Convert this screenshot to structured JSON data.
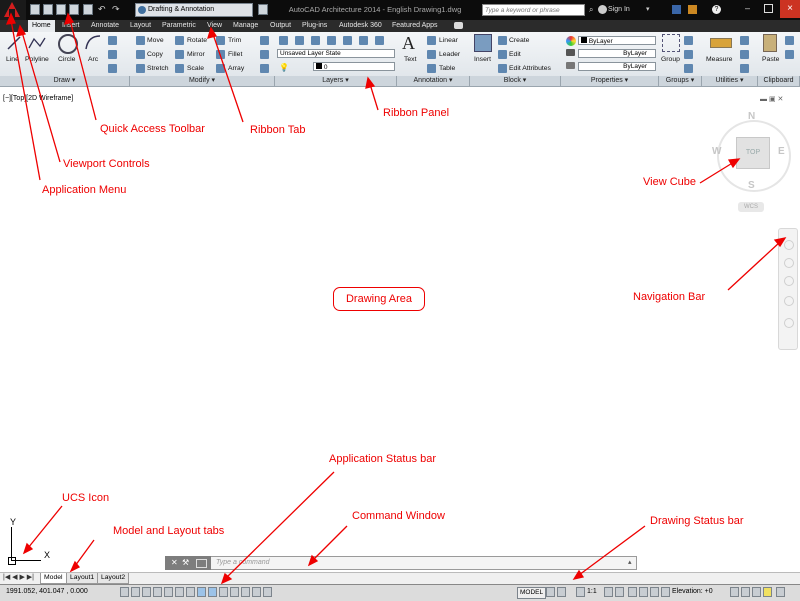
{
  "title_bar": {
    "workspace": "Drafting & Annotation",
    "title": "AutoCAD Architecture 2014 - English    Drawing1.dwg",
    "search_placeholder": "Type a keyword or phrase",
    "sign_in": "Sign In"
  },
  "tabs": [
    "Home",
    "Insert",
    "Annotate",
    "Layout",
    "Parametric",
    "View",
    "Manage",
    "Output",
    "Plug-ins",
    "Autodesk 360",
    "Featured Apps"
  ],
  "ribbon": {
    "draw": {
      "line": "Line",
      "polyline": "Polyline",
      "circle": "Circle",
      "arc": "Arc",
      "title": "Draw"
    },
    "modify": {
      "move": "Move",
      "rotate": "Rotate",
      "trim": "Trim",
      "copy": "Copy",
      "mirror": "Mirror",
      "fillet": "Fillet",
      "stretch": "Stretch",
      "scale": "Scale",
      "array": "Array",
      "title": "Modify"
    },
    "layers": {
      "state": "Unsaved Layer State",
      "current": "0",
      "title": "Layers"
    },
    "annotation": {
      "text": "Text",
      "linear": "Linear",
      "leader": "Leader",
      "table": "Table",
      "title": "Annotation"
    },
    "block": {
      "insert": "Insert",
      "create": "Create",
      "edit": "Edit",
      "edit_attributes": "Edit Attributes",
      "title": "Block"
    },
    "properties": {
      "color": "ByLayer",
      "linetype": "ByLayer",
      "lineweight": "ByLayer",
      "title": "Properties"
    },
    "groups": {
      "group": "Group",
      "title": "Groups"
    },
    "utilities": {
      "measure": "Measure",
      "title": "Utilities"
    },
    "clipboard": {
      "paste": "Paste",
      "title": "Clipboard"
    }
  },
  "viewport": {
    "label": "[−][Top][2D Wireframe]"
  },
  "viewcube": {
    "top": "TOP",
    "n": "N",
    "s": "S",
    "e": "E",
    "w": "W",
    "wcs": "WCS"
  },
  "ucs": {
    "x": "X",
    "y": "Y"
  },
  "command": {
    "placeholder": "Type a command"
  },
  "layout_tabs": [
    "Model",
    "Layout1",
    "Layout2"
  ],
  "status": {
    "coords": "1991.052, 401.047 , 0.000",
    "model": "MODEL",
    "scale": "1:1",
    "elevation": "Elevation: +0"
  },
  "annotations": {
    "application_menu": "Application Menu",
    "quick_access_toolbar": "Quick Access Toolbar",
    "ribbon_tab": "Ribbon Tab",
    "ribbon_panel": "Ribbon Panel",
    "viewport_controls": "Viewport Controls",
    "view_cube": "View Cube",
    "drawing_area": "Drawing Area",
    "navigation_bar": "Navigation Bar",
    "application_status_bar": "Application Status bar",
    "ucs_icon": "UCS Icon",
    "model_layout_tabs": "Model and Layout tabs",
    "command_window": "Command Window",
    "drawing_status_bar": "Drawing Status bar"
  }
}
